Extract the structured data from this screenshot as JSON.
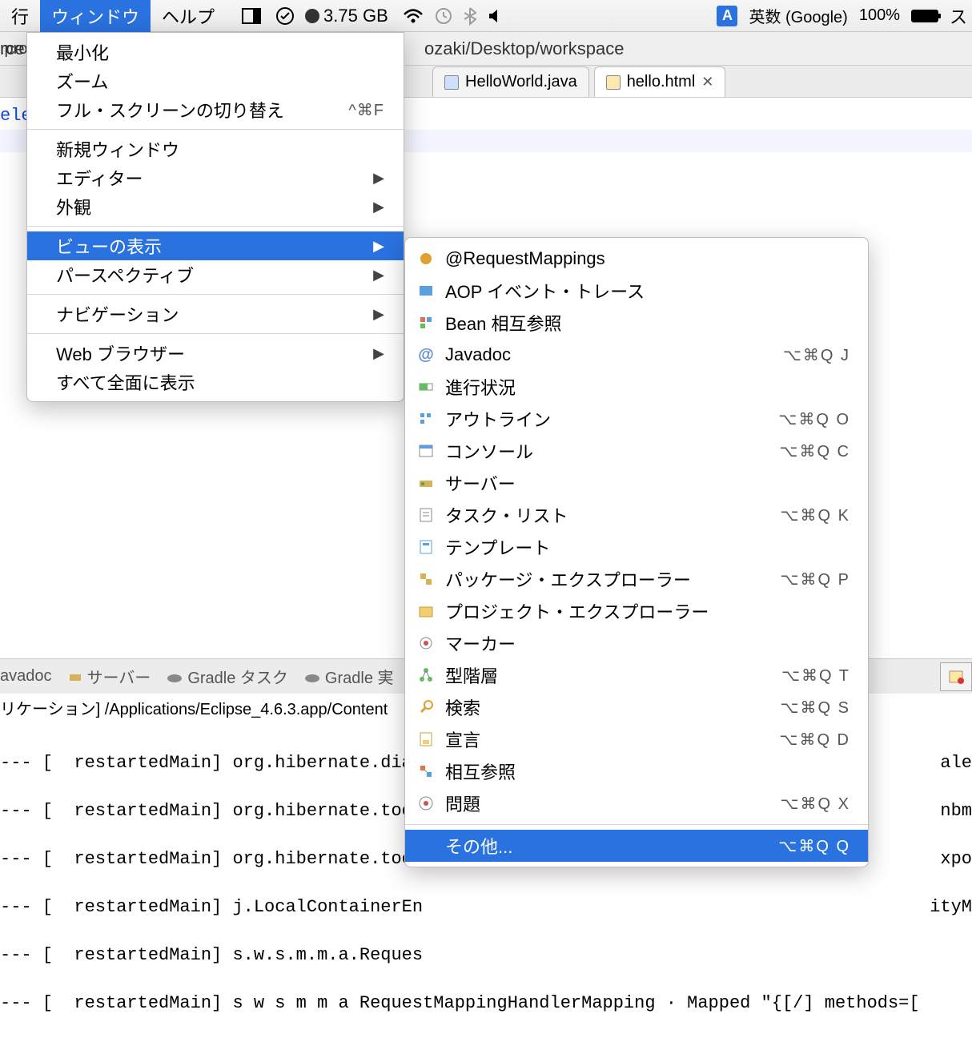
{
  "menubar": {
    "left_cut": "行",
    "active": "ウィンドウ",
    "help": "ヘルプ",
    "memory": "3.75 GB",
    "ime": "A",
    "ime_label": "英数 (Google)",
    "battery_pct": "100%"
  },
  "pathbar": {
    "left_cut": "rce",
    "path": "ozaki/Desktop/workspace"
  },
  "tabs": {
    "left_cut": ".pro",
    "t1": "HelloWorld.java",
    "t2": "hello.html"
  },
  "editor": {
    "left_cut": "ele"
  },
  "menu": {
    "minimize": "最小化",
    "zoom": "ズーム",
    "fullscreen": "フル・スクリーンの切り替え",
    "fullscreen_sc": "^⌘F",
    "new_window": "新規ウィンドウ",
    "editor": "エディター",
    "appearance": "外観",
    "show_view": "ビューの表示",
    "perspective": "パースペクティブ",
    "navigation": "ナビゲーション",
    "web_browser": "Web ブラウザー",
    "bring_all": "すべて全面に表示"
  },
  "submenu": {
    "items": [
      {
        "label": "@RequestMappings",
        "shortcut": "",
        "icon": "req"
      },
      {
        "label": "AOP イベント・トレース",
        "shortcut": "",
        "icon": "aop"
      },
      {
        "label": "Bean 相互参照",
        "shortcut": "",
        "icon": "bean"
      },
      {
        "label": "Javadoc",
        "shortcut": "⌥⌘Q J",
        "icon": "at"
      },
      {
        "label": "進行状況",
        "shortcut": "",
        "icon": "prog"
      },
      {
        "label": "アウトライン",
        "shortcut": "⌥⌘Q O",
        "icon": "outl"
      },
      {
        "label": "コンソール",
        "shortcut": "⌥⌘Q C",
        "icon": "cons"
      },
      {
        "label": "サーバー",
        "shortcut": "",
        "icon": "srv"
      },
      {
        "label": "タスク・リスト",
        "shortcut": "⌥⌘Q K",
        "icon": "task"
      },
      {
        "label": "テンプレート",
        "shortcut": "",
        "icon": "tmpl"
      },
      {
        "label": "パッケージ・エクスプローラー",
        "shortcut": "⌥⌘Q P",
        "icon": "pkg"
      },
      {
        "label": "プロジェクト・エクスプローラー",
        "shortcut": "",
        "icon": "proj"
      },
      {
        "label": "マーカー",
        "shortcut": "",
        "icon": "mark"
      },
      {
        "label": "型階層",
        "shortcut": "⌥⌘Q T",
        "icon": "hier"
      },
      {
        "label": "検索",
        "shortcut": "⌥⌘Q S",
        "icon": "srch"
      },
      {
        "label": "宣言",
        "shortcut": "⌥⌘Q D",
        "icon": "decl"
      },
      {
        "label": "相互参照",
        "shortcut": "",
        "icon": "xref"
      },
      {
        "label": "問題",
        "shortcut": "⌥⌘Q X",
        "icon": "prob"
      }
    ],
    "other": "その他...",
    "other_sc": "⌥⌘Q Q"
  },
  "bottom_tabs": {
    "t0": "avadoc",
    "t1": "サーバー",
    "t2": "Gradle タスク",
    "t3": "Gradle 実"
  },
  "console_header": "リケーション] /Applications/Eclipse_4.6.3.app/Content",
  "console": {
    "lines": [
      "--- [  restartedMain] org.hibernate.dial",
      "--- [  restartedMain] org.hibernate.tool",
      "--- [  restartedMain] org.hibernate.tool",
      "--- [  restartedMain] j.LocalContainerEn",
      "--- [  restartedMain] s.w.s.m.m.a.Reques",
      "--- [  restartedMain] s w s m m a RequestMappingHandlerMapping · Mapped \"{[/] methods=["
    ],
    "right": [
      "ale",
      "nbm",
      "xpo",
      "ityM"
    ]
  }
}
